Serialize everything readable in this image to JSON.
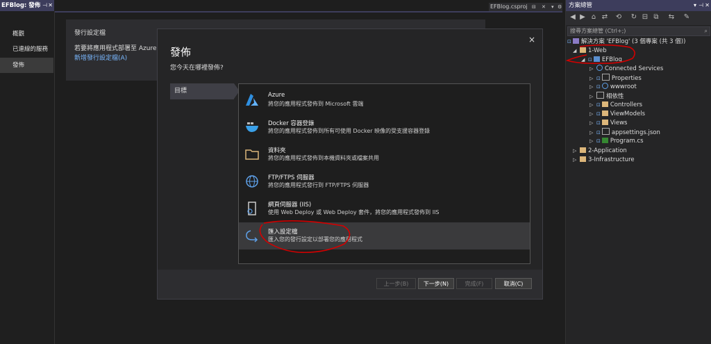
{
  "left_tab": {
    "title": "EFBlog: 發佈",
    "pin": "⊣",
    "close": "✕"
  },
  "left_nav": {
    "items": [
      {
        "label": "概觀"
      },
      {
        "label": "已連線的服務"
      },
      {
        "label": "發佈"
      }
    ]
  },
  "file_tab": {
    "title": "EFBlog.csproj"
  },
  "background_panel": {
    "title": "發行設定檔",
    "text": "若要將應用程式部署至 Azure、II",
    "link": "新增發行設定檔(A)"
  },
  "dialog": {
    "close": "×",
    "title": "發佈",
    "subtitle": "您今天在哪裡發佈?",
    "step": "目標",
    "options": [
      {
        "name": "Azure",
        "desc": "將您的應用程式發佈到 Microsoft 雲端",
        "icon": "azure-icon"
      },
      {
        "name": "Docker 容器登錄",
        "desc": "將您的應用程式發佈到所有可使用 Docker 映像的受支援容器登錄",
        "icon": "docker-icon"
      },
      {
        "name": "資料夾",
        "desc": "將您的應用程式發佈到本機資料夾或檔案共用",
        "icon": "folder-icon"
      },
      {
        "name": "FTP/FTPS 伺服器",
        "desc": "將您的應用程式發行到 FTP/FTPS 伺服器",
        "icon": "globe-icon"
      },
      {
        "name": "網頁伺服器 (IIS)",
        "desc": "使用 Web Deploy 或 Web Deploy 套件，將您的應用程式發佈到 IIS",
        "icon": "server-icon"
      },
      {
        "name": "匯入設定檔",
        "desc": "匯入您的發行設定以部署您的應用程式",
        "icon": "import-icon"
      }
    ],
    "selected_index": 5,
    "buttons": {
      "back": "上一步(B)",
      "next": "下一步(N)",
      "finish": "完成(F)",
      "cancel": "取消(C)"
    }
  },
  "solution_explorer": {
    "title": "方案總管",
    "search_placeholder": "搜尋方案總管 (Ctrl+;)",
    "solution": "解決方案 'EFBlog' (3 個專案 (共 3 個))",
    "nodes": [
      {
        "label": "1-Web",
        "type": "folder"
      },
      {
        "label": "EFBlog",
        "type": "project"
      },
      {
        "label": "Connected Services",
        "type": "service"
      },
      {
        "label": "Properties",
        "type": "properties"
      },
      {
        "label": "wwwroot",
        "type": "globe"
      },
      {
        "label": "相依性",
        "type": "deps"
      },
      {
        "label": "Controllers",
        "type": "folder"
      },
      {
        "label": "ViewModels",
        "type": "folder"
      },
      {
        "label": "Views",
        "type": "folder"
      },
      {
        "label": "appsettings.json",
        "type": "json"
      },
      {
        "label": "Program.cs",
        "type": "cs"
      },
      {
        "label": "2-Application",
        "type": "folder"
      },
      {
        "label": "3-Infrastructure",
        "type": "folder"
      }
    ]
  },
  "colors": {
    "accent": "#3d3d5c",
    "link": "#7ab8ff",
    "annotation": "#d40000"
  }
}
